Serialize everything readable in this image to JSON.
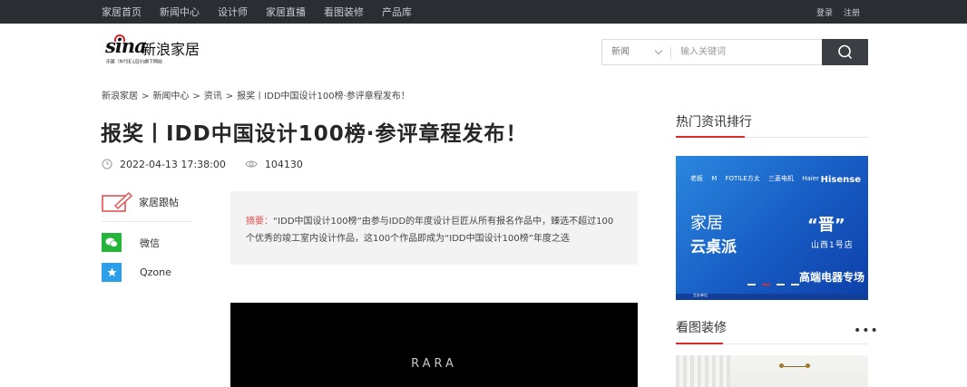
{
  "topnav": {
    "items": [
      "家居首页",
      "新闻中心",
      "设计师",
      "家居直播",
      "看图装修",
      "产品库"
    ],
    "login": "登录",
    "register": "注册"
  },
  "logo": {
    "mark": "sina",
    "name": "新浪家居",
    "sub": "乐居（NYSE:LEJU)旗下网站"
  },
  "search": {
    "category": "新闻",
    "placeholder": "输入关键词"
  },
  "breadcrumb": [
    "新浪家居",
    "新闻中心",
    "资讯",
    "报奖丨IDD中国设计100榜·参评章程发布！"
  ],
  "article": {
    "title": "报奖丨IDD中国设计100榜·参评章程发布！",
    "datetime": "2022-04-13 17:38:00",
    "views": "104130",
    "summary_label": "摘要：",
    "summary_text": "“IDD中国设计100榜”由参与IDD的年度设计巨匠从所有报名作品中，臻选不超过100个优秀的竣工室内设计作品，这100个作品即成为“IDD中国设计100榜”年度之选",
    "video_brand": "RARA"
  },
  "share": {
    "follow": "家居跟帖",
    "wechat": "微信",
    "qzone": "Qzone"
  },
  "sidebar": {
    "hot_title": "热门资讯排行",
    "gallery_title": "看图装修",
    "more": "•••"
  },
  "ad": {
    "logos": [
      "老板",
      "M",
      "FOTILE方太",
      "三菱电机",
      "Haier"
    ],
    "hisense": "Hisense",
    "line1": "家居",
    "line2": "云桌派",
    "quote": "“晋”",
    "quote_sub": "山西1号店",
    "bottom": "高端电器专场",
    "foot": "主办单位"
  },
  "colors": {
    "topbar": "#2a2d31",
    "accent_red": "#db2c2c",
    "wechat": "#27b43a",
    "qzone": "#2d9ee8"
  }
}
